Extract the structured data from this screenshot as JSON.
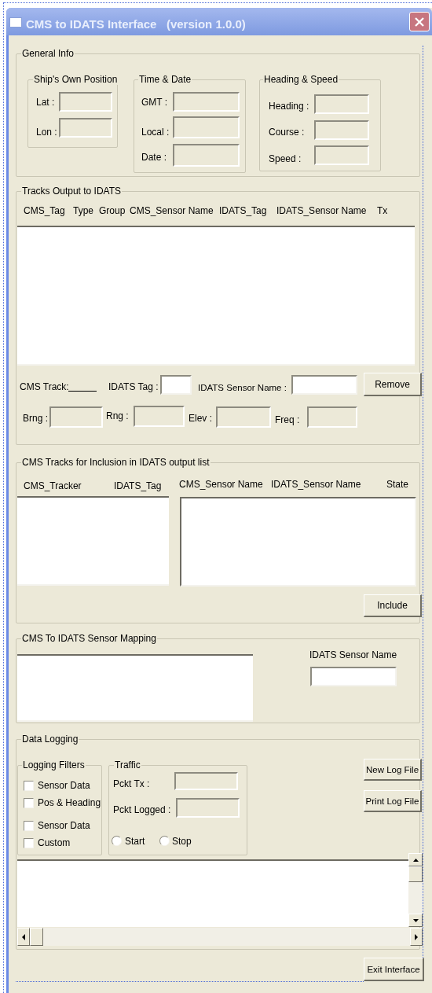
{
  "window": {
    "title": "CMS to IDATS Interface   (version 1.0.0)"
  },
  "general_info": {
    "title": "General Info",
    "groups": [
      {
        "title": "Ship's Own Position",
        "fields": [
          {
            "label": "Lat :"
          },
          {
            "label": "Lon :"
          }
        ]
      },
      {
        "title": "Time & Date",
        "fields": [
          {
            "label": "GMT :"
          },
          {
            "label": "Local :"
          },
          {
            "label": "Date :"
          }
        ]
      },
      {
        "title": "Heading & Speed",
        "fields": [
          {
            "label": "Heading :"
          },
          {
            "label": "Course :"
          },
          {
            "label": "Speed :"
          }
        ]
      }
    ]
  },
  "tracks_output": {
    "title": "Tracks Output to IDATS",
    "columns": [
      "CMS_Tag",
      "Type",
      "Group",
      "CMS_Sensor Name",
      "IDATS_Tag",
      "IDATS_Sensor Name",
      "Tx"
    ],
    "cms_track_label": "CMS Track:",
    "idats_tag_label": "IDATS Tag :",
    "idats_sensor_name_label": "IDATS Sensor Name :",
    "remove_button": "Remove",
    "readouts": [
      {
        "label": "Brng :"
      },
      {
        "label": "Rng :"
      },
      {
        "label": "Elev :"
      },
      {
        "label": "Freq :"
      }
    ]
  },
  "tracks_inclusion": {
    "title": "CMS Tracks for Inclusion in IDATS output list",
    "tracker_columns": [
      "CMS_Tracker",
      "IDATS_Tag"
    ],
    "sensor_columns": [
      "CMS_Sensor Name",
      "IDATS_Sensor Name",
      "State"
    ],
    "include_button": "Include"
  },
  "sensor_mapping": {
    "title": "CMS To IDATS Sensor Mapping",
    "idats_sensor_name_label": "IDATS Sensor Name"
  },
  "data_logging": {
    "title": "Data Logging",
    "filters": {
      "title": "Logging Filters",
      "items": [
        {
          "label": "Sensor Data",
          "checked": false
        },
        {
          "label": "Pos & Heading",
          "checked": false
        },
        {
          "label": "Sensor Data",
          "checked": false
        },
        {
          "label": "Custom",
          "checked": false
        }
      ]
    },
    "traffic": {
      "title": "Traffic",
      "fields": [
        {
          "label": "Pckt Tx :"
        },
        {
          "label": "Pckt Logged :"
        }
      ],
      "modes": [
        {
          "label": "Start",
          "selected": false
        },
        {
          "label": "Stop",
          "selected": false
        }
      ]
    },
    "buttons": [
      "New Log File",
      "Print Log File"
    ]
  },
  "exit_button": "Exit Interface"
}
